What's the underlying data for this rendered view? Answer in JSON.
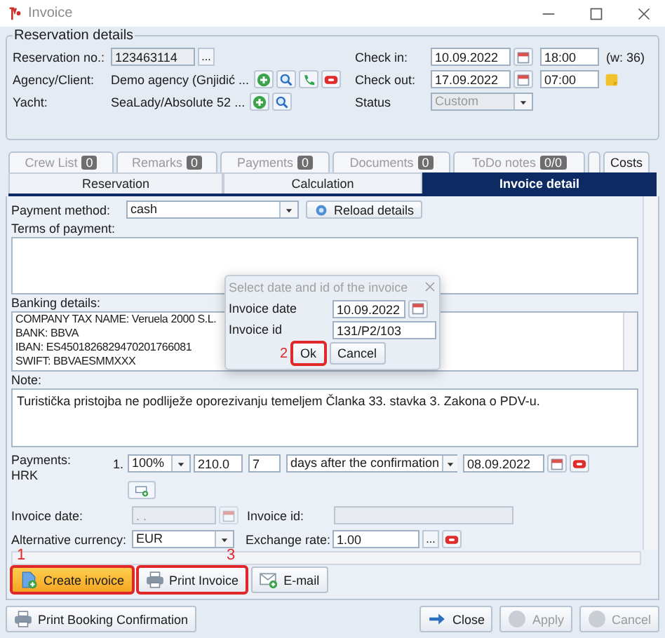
{
  "window": {
    "title": "Invoice"
  },
  "reservation_details": {
    "title": "Reservation details",
    "reservation_no": {
      "label": "Reservation no.:",
      "value": "123463114",
      "button": "..."
    },
    "agency_client": {
      "label": "Agency/Client:",
      "value": "Demo agency (Gnjidić ..."
    },
    "yacht": {
      "label": "Yacht:",
      "value": "SeaLady/Absolute 52 ..."
    },
    "check_in": {
      "label": "Check in:",
      "date": "10.09.2022",
      "time": "18:00",
      "week": "(w: 36)"
    },
    "check_out": {
      "label": "Check out:",
      "date": "17.09.2022",
      "time": "07:00"
    },
    "status": {
      "label": "Status",
      "value": "Custom",
      "disabled": true
    }
  },
  "tabs_top": [
    {
      "label": "Crew List",
      "count": "0",
      "disabled": true
    },
    {
      "label": "Remarks",
      "count": "0",
      "disabled": true
    },
    {
      "label": "Payments",
      "count": "0",
      "disabled": true
    },
    {
      "label": "Documents",
      "count": "0",
      "disabled": true
    },
    {
      "label": "ToDo notes",
      "count": "0/0",
      "disabled": true
    },
    {
      "label": "Costs",
      "disabled": false
    }
  ],
  "tabs": [
    {
      "label": "Reservation",
      "selected": false
    },
    {
      "label": "Calculation",
      "selected": false
    },
    {
      "label": "Invoice detail",
      "selected": true
    }
  ],
  "invoice_detail": {
    "payment_method": {
      "label": "Payment method:",
      "value": "cash"
    },
    "reload_button": "Reload details",
    "terms": {
      "label": "Terms of payment:"
    },
    "banking": {
      "label": "Banking details:",
      "lines": [
        "COMPANY TAX NAME: Veruela 2000 S.L.",
        "BANK: BBVA",
        "IBAN: ES4501826829470201766081",
        "SWIFT: BBVAESMMXXX"
      ]
    },
    "note": {
      "label": "Note:",
      "text": "Turistička pristojba ne podliježe oporezivanju temeljem Članka 33. stavka 3. Zakona o PDV-u."
    },
    "payments": {
      "label": "Payments:",
      "currency": "HRK",
      "rows": [
        {
          "number": "1.",
          "percent": "100%",
          "amount": "210.0",
          "days": "7",
          "rule": "days after the confirmation",
          "date": "08.09.2022"
        }
      ]
    },
    "invoice_date": {
      "label": "Invoice date:",
      "placeholder": ". .",
      "disabled": true
    },
    "invoice_id": {
      "label": "Invoice id:",
      "disabled": true
    },
    "alternative_currency": {
      "label": "Alternative currency:",
      "value": "EUR"
    },
    "exchange_rate": {
      "label": "Exchange rate:",
      "value": "1.00",
      "button": "..."
    }
  },
  "actions": [
    {
      "label": "Create invoice",
      "kind": "create",
      "primary": true,
      "highlighted": true,
      "marker": "1"
    },
    {
      "label": "Print Invoice",
      "kind": "print",
      "primary": false,
      "highlighted": true,
      "marker": "3"
    },
    {
      "label": "E-mail",
      "kind": "email",
      "primary": false,
      "highlighted": false
    }
  ],
  "footer": {
    "left": [
      {
        "label": "Print Booking Confirmation",
        "kind": "print",
        "disabled": false
      }
    ],
    "right": [
      {
        "label": "Close",
        "kind": "close",
        "disabled": false
      },
      {
        "label": "Apply",
        "kind": "apply",
        "disabled": true
      },
      {
        "label": "Cancel",
        "kind": "cancel",
        "disabled": true
      }
    ]
  },
  "dialog": {
    "title": "Select date and id of the invoice",
    "invoice_date": {
      "label": "Invoice date",
      "value": "10.09.2022"
    },
    "invoice_id": {
      "label": "Invoice id",
      "value": "131/P2/103"
    },
    "buttons": [
      {
        "label": "Ok",
        "highlighted": true,
        "marker": "2"
      },
      {
        "label": "Cancel",
        "highlighted": false
      }
    ]
  }
}
